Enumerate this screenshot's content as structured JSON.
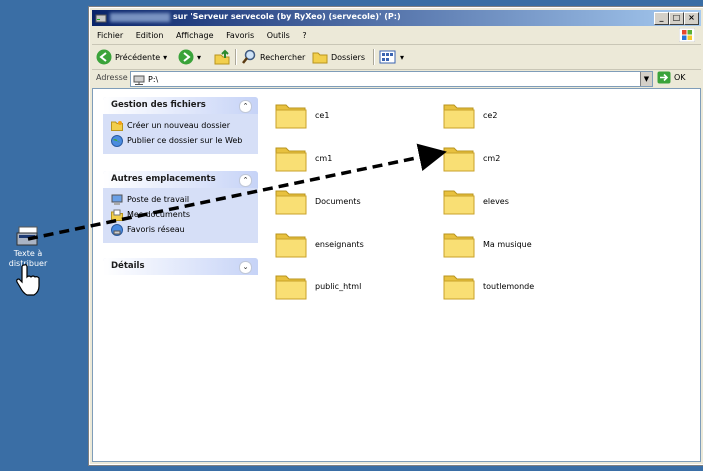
{
  "desktop": {
    "icon_label": "Texte à distribuer",
    "icon": "text-document-icon"
  },
  "window": {
    "title": "sur 'Serveur servecole (by RyXeo) (servecole)' (P:)",
    "buttons": {
      "minimize": "_",
      "maximize": "□",
      "close": "×"
    },
    "menu": [
      "Fichier",
      "Edition",
      "Affichage",
      "Favoris",
      "Outils",
      "?"
    ],
    "toolbar": {
      "back": "Précédente",
      "search": "Rechercher",
      "folders": "Dossiers"
    },
    "address": {
      "label": "Adresse",
      "value": "P:\\",
      "go": "OK"
    }
  },
  "sidebar": {
    "file_tasks": {
      "title": "Gestion des fichiers",
      "items": [
        "Créer un nouveau dossier",
        "Publier ce dossier sur le Web"
      ]
    },
    "other_places": {
      "title": "Autres emplacements",
      "items": [
        "Poste de travail",
        "Mes documents",
        "Favoris réseau"
      ]
    },
    "details": {
      "title": "Détails"
    }
  },
  "folders": [
    "ce1",
    "ce2",
    "cm1",
    "cm2",
    "Documents",
    "eleves",
    "enseignants",
    "Ma musique",
    "public_html",
    "toutlemonde"
  ],
  "colors": {
    "desktop": "#3a6ea5",
    "titlebar_start": "#0a246a",
    "titlebar_end": "#a6caf0",
    "panel_bg": "#d6dff7",
    "folder_yellow": "#f7d75a"
  }
}
